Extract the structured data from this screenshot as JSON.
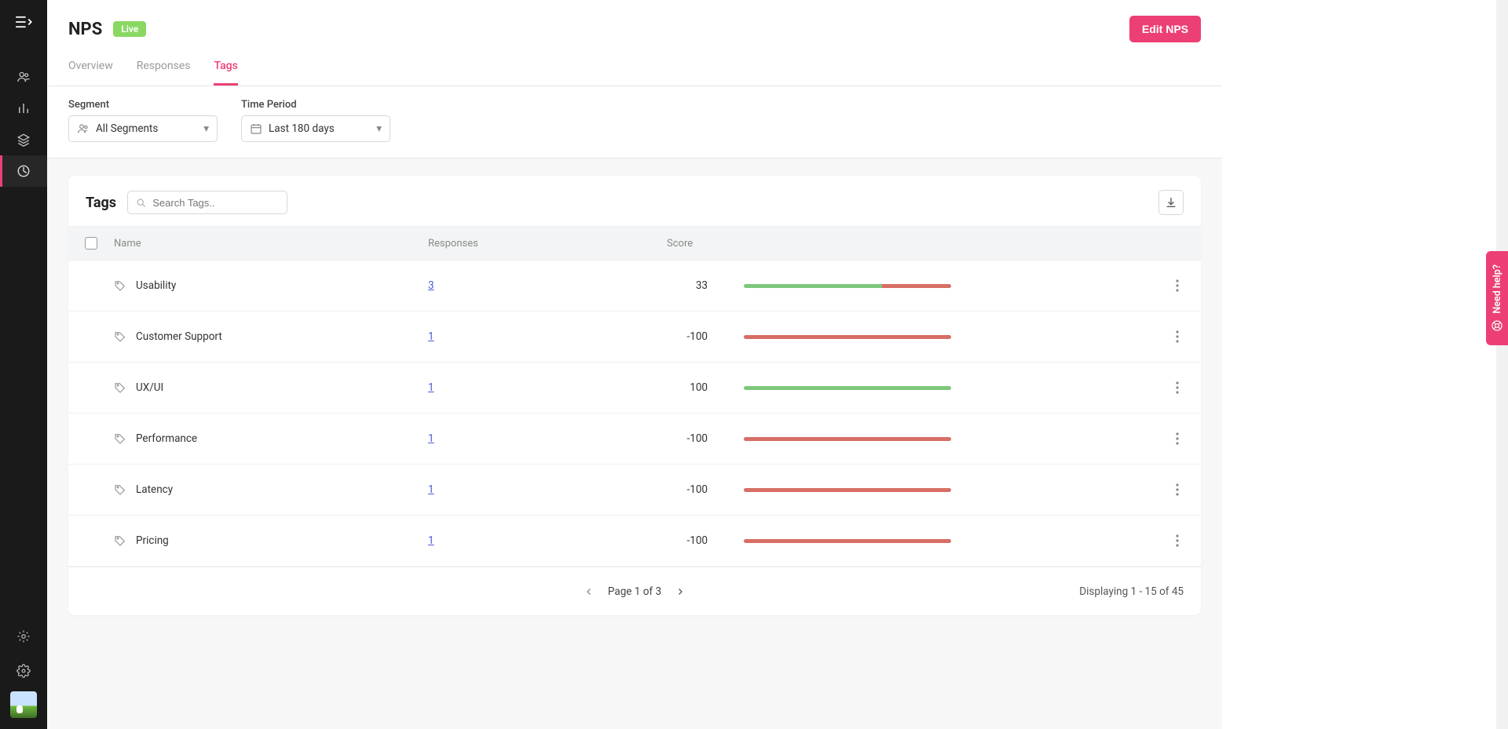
{
  "header": {
    "title": "NPS",
    "badge": "Live",
    "edit_label": "Edit NPS"
  },
  "tabs": [
    {
      "label": "Overview"
    },
    {
      "label": "Responses"
    },
    {
      "label": "Tags"
    }
  ],
  "active_tab": 2,
  "filters": {
    "segment": {
      "label": "Segment",
      "value": "All Segments"
    },
    "period": {
      "label": "Time Period",
      "value": "Last 180 days"
    }
  },
  "table": {
    "section_title": "Tags",
    "search_placeholder": "Search Tags..",
    "columns": {
      "name": "Name",
      "responses": "Responses",
      "score": "Score"
    },
    "rows": [
      {
        "name": "Usability",
        "responses": "3",
        "score": "33",
        "green_pct": 66.5,
        "red_pct": 33.5
      },
      {
        "name": "Customer Support",
        "responses": "1",
        "score": "-100",
        "green_pct": 0,
        "red_pct": 100
      },
      {
        "name": "UX/UI",
        "responses": "1",
        "score": "100",
        "green_pct": 100,
        "red_pct": 0
      },
      {
        "name": "Performance",
        "responses": "1",
        "score": "-100",
        "green_pct": 0,
        "red_pct": 100
      },
      {
        "name": "Latency",
        "responses": "1",
        "score": "-100",
        "green_pct": 0,
        "red_pct": 100
      },
      {
        "name": "Pricing",
        "responses": "1",
        "score": "-100",
        "green_pct": 0,
        "red_pct": 100
      }
    ]
  },
  "pagination": {
    "page_text": "Page 1 of 3",
    "display_text": "Displaying 1 - 15 of 45"
  },
  "need_help": "Need help?",
  "colors": {
    "accent": "#ec4074",
    "badge_green": "#8ad862",
    "bar_green": "#7ec87b",
    "bar_red": "#d86e66"
  }
}
